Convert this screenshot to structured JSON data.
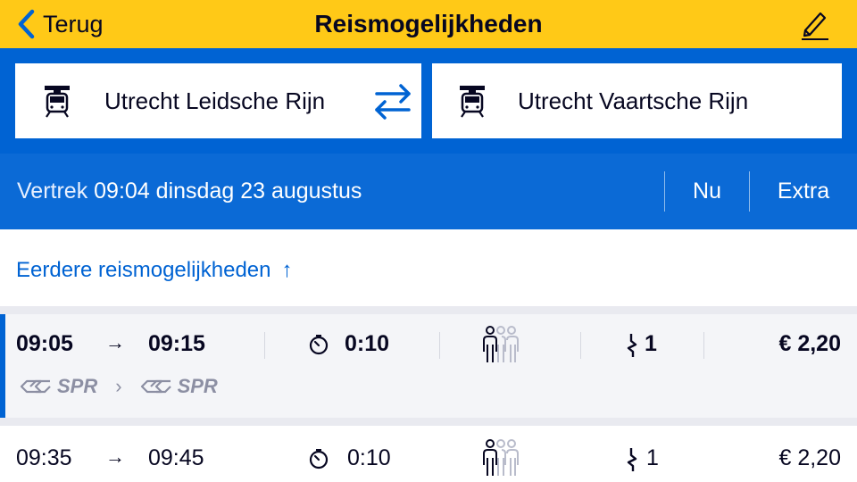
{
  "header": {
    "back_label": "Terug",
    "title": "Reismogelijkheden",
    "background": "#ffc917"
  },
  "planner": {
    "from_station": "Utrecht Leidsche Rijn",
    "to_station": "Utrecht Vaartsche Rijn",
    "from_icon": "train-station-icon",
    "to_icon": "train-station-icon",
    "swap_icon": "swap-arrows-icon",
    "accent": "#0063d3"
  },
  "departure": {
    "label": "Vertrek",
    "time": "09:04",
    "date": "dinsdag 23 augustus",
    "now_button": "Nu",
    "extra_button": "Extra"
  },
  "earlier": {
    "label": "Eerdere reismogelijkheden",
    "arrow": "↑"
  },
  "trips": [
    {
      "depart": "09:05",
      "arrow": "→",
      "arrive": "09:15",
      "duration": "0:10",
      "crowding": "low",
      "transfers": "1",
      "price": "€ 2,20",
      "selected": true,
      "products": [
        "SPR",
        "SPR"
      ],
      "product_separator": "›"
    },
    {
      "depart": "09:35",
      "arrow": "→",
      "arrive": "09:45",
      "duration": "0:10",
      "crowding": "low",
      "transfers": "1",
      "price": "€ 2,20",
      "selected": false
    }
  ]
}
